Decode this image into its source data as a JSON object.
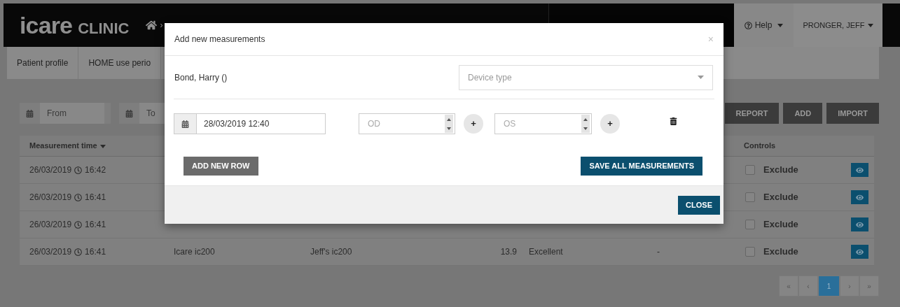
{
  "header": {
    "logo": "icare",
    "logo_suffix": "CLINIC",
    "breadcrumb_separator": "›",
    "help": "Help",
    "user": "PRONGER, JEFF"
  },
  "subnav": [
    "Patient profile",
    "HOME use perio"
  ],
  "filters": {
    "from": {
      "placeholder": "From"
    },
    "to": {
      "placeholder": "To"
    }
  },
  "actions": [
    "REPORT",
    "ADD",
    "IMPORT"
  ],
  "table": {
    "columns": [
      {
        "label": "Measurement time",
        "sorted": true
      },
      {
        "label": "Controls"
      }
    ],
    "rows": [
      {
        "date": "26/03/2019",
        "time": "16:42",
        "exclude": "Exclude",
        "checked": false
      },
      {
        "date": "26/03/2019",
        "time": "16:41",
        "exclude": "Exclude",
        "checked": false
      },
      {
        "date": "26/03/2019",
        "time": "16:41",
        "exclude": "Exclude",
        "checked": false
      },
      {
        "date": "26/03/2019",
        "time": "16:41",
        "device": "Icare ic200",
        "device_name": "Jeff's ic200",
        "iop": "13.9",
        "quality": "Excellent",
        "comment": "-",
        "exclude": "Exclude",
        "checked": false
      }
    ]
  },
  "pagination": [
    {
      "label": "«",
      "selected": false
    },
    {
      "label": "‹",
      "selected": false
    },
    {
      "label": "1",
      "selected": true
    },
    {
      "label": "›",
      "selected": false
    },
    {
      "label": "»",
      "selected": false
    }
  ],
  "modal": {
    "title": "Add new measurements",
    "close_icon": "×",
    "patient": "Bond, Harry ()",
    "device_select": {
      "placeholder": "Device type"
    },
    "rows": [
      {
        "date": "28/03/2019 12:40",
        "od": {
          "placeholder": "OD"
        },
        "os": {
          "placeholder": "OS"
        },
        "add_symbol": "+"
      }
    ],
    "add_row": "ADD NEW ROW",
    "save": "SAVE ALL MEASUREMENTS",
    "close_button": "CLOSE"
  }
}
